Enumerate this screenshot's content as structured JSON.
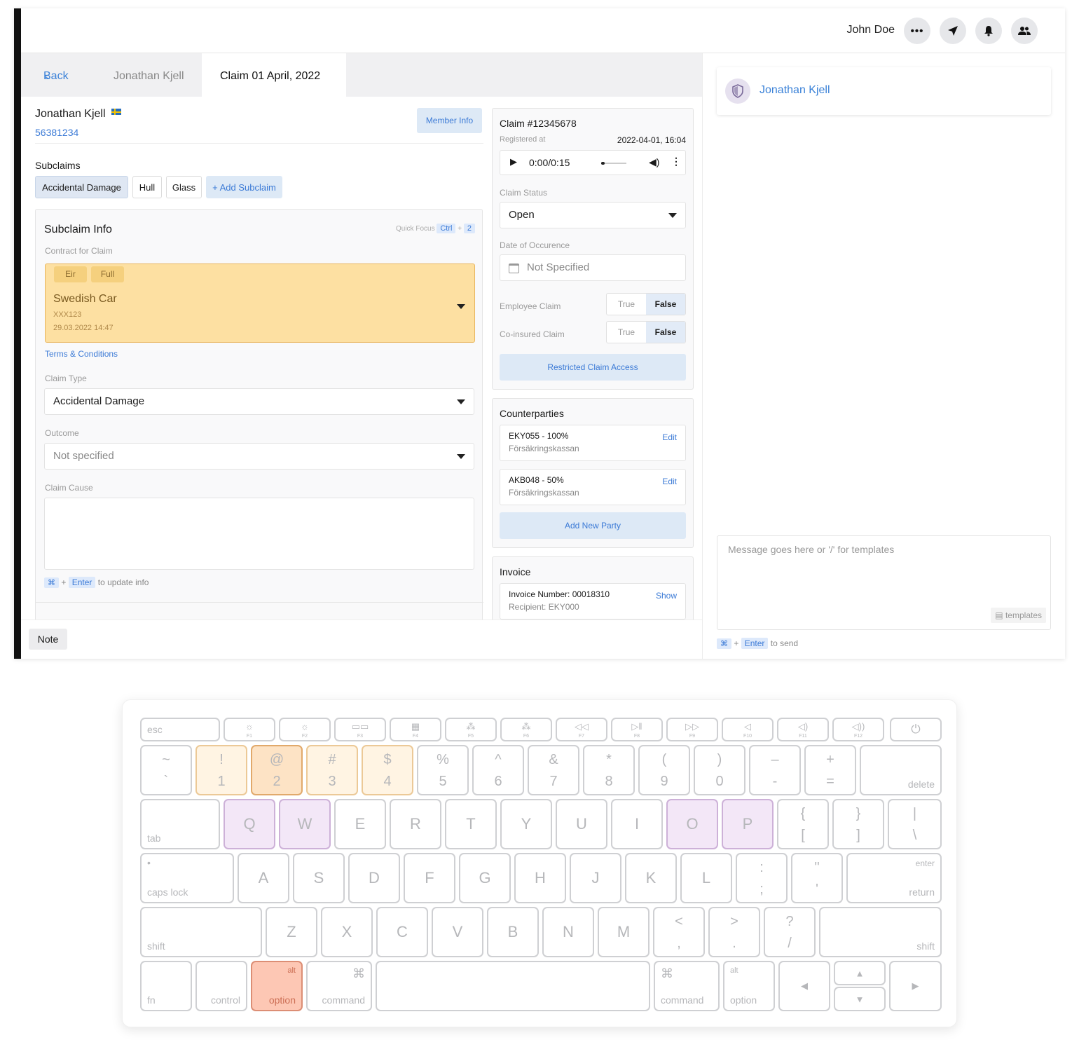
{
  "topbar": {
    "user": "John Doe",
    "dots_icon": "ellipsis-icon",
    "send_icon": "send-icon",
    "bell_icon": "bell-icon",
    "people_icon": "users-icon",
    "expand_glyph": "›"
  },
  "tabs": {
    "back": "Back",
    "member": "Jonathan Kjell",
    "claim": "Claim 01 April, 2022"
  },
  "member": {
    "name": "Jonathan Kjell",
    "flag": "sweden-flag",
    "id": "56381234",
    "info_button": "Member Info"
  },
  "subclaims": {
    "label": "Subclaims",
    "items": [
      "Accidental Damage",
      "Hull",
      "Glass"
    ],
    "add": "+ Add Subclaim"
  },
  "subclaim_info": {
    "title": "Subclaim Info",
    "quick_focus": "Quick Focus",
    "qf_key1": "Ctrl",
    "qf_plus": "+",
    "qf_key2": "2",
    "contract_label": "Contract for Claim",
    "contract_tags": [
      "Eir",
      "Full"
    ],
    "contract_title": "Swedish Car",
    "contract_reg": "XXX123",
    "contract_date": "29.03.2022 14:47",
    "terms": "Terms & Conditions",
    "claim_type_label": "Claim Type",
    "claim_type": "Accidental Damage",
    "outcome_label": "Outcome",
    "outcome": "Not specified",
    "cause_label": "Claim Cause",
    "hint_key1": "⌘",
    "hint_plus": "+",
    "hint_key2": "Enter",
    "hint_text": "to update info"
  },
  "note": "Note",
  "claim": {
    "number": "Claim #12345678",
    "registered_label": "Registered at",
    "registered": "2022-04-01, 16:04",
    "audio_time": "0:00/0:15",
    "status_label": "Claim Status",
    "status": "Open",
    "date_label": "Date of Occurence",
    "date": "Not Specified",
    "employee_label": "Employee Claim",
    "coinsured_label": "Co-insured Claim",
    "true_label": "True",
    "false_label": "False",
    "restricted": "Restricted Claim Access"
  },
  "counterparties": {
    "title": "Counterparties",
    "items": [
      {
        "name": "EKY055 - 100%",
        "org": "Försäkringskassan",
        "edit": "Edit"
      },
      {
        "name": "AKB048 - 50%",
        "org": "Försäkringskassan",
        "edit": "Edit"
      }
    ],
    "add": "Add New Party"
  },
  "invoice": {
    "title": "Invoice",
    "number": "Invoice Number: 00018310",
    "recipient": "Recipient: EKY000",
    "show": "Show"
  },
  "chat": {
    "contact": "Jonathan Kjell",
    "placeholder": "Message goes here or '/' for templates",
    "templates": "templates",
    "hint_key1": "⌘",
    "hint_plus": "+",
    "hint_key2": "Enter",
    "hint_text": "to send"
  },
  "keyboard": {
    "esc": "esc",
    "fn_keys": [
      "F1",
      "F2",
      "F3",
      "F4",
      "F5",
      "F6",
      "F7",
      "F8",
      "F9",
      "F10",
      "F11",
      "F12"
    ],
    "fn_icons": [
      "☼",
      "☼",
      "▭▭",
      "▦",
      "⁂",
      "⁂",
      "◁◁",
      "▷‖",
      "▷▷",
      "◁",
      "◁)",
      "◁))"
    ],
    "power": "⏻",
    "row1": [
      [
        "~",
        "`"
      ],
      [
        "!",
        "1"
      ],
      [
        "@",
        "2"
      ],
      [
        "#",
        "3"
      ],
      [
        "$",
        "4"
      ],
      [
        "%",
        "5"
      ],
      [
        "^",
        "6"
      ],
      [
        "&",
        "7"
      ],
      [
        "*",
        "8"
      ],
      [
        "(",
        "9"
      ],
      [
        ")",
        "0"
      ],
      [
        "–",
        "-"
      ],
      [
        "+",
        "="
      ]
    ],
    "delete": "delete",
    "tab": "tab",
    "row2": [
      "Q",
      "W",
      "E",
      "R",
      "T",
      "Y",
      "U",
      "I",
      "O",
      "P"
    ],
    "row2b": [
      [
        "{",
        "["
      ],
      [
        "}",
        "]"
      ],
      [
        "|",
        "\\"
      ]
    ],
    "caps_dot": "•",
    "caps": "caps lock",
    "row3": [
      "A",
      "S",
      "D",
      "F",
      "G",
      "H",
      "J",
      "K",
      "L"
    ],
    "row3b": [
      [
        ":",
        ";"
      ],
      [
        "\"",
        "'"
      ]
    ],
    "enter": "enter",
    "return": "return",
    "shift": "shift",
    "row4": [
      "Z",
      "X",
      "C",
      "V",
      "B",
      "N",
      "M"
    ],
    "row4b": [
      [
        "<",
        ","
      ],
      [
        ">",
        "."
      ],
      [
        "?",
        "/"
      ]
    ],
    "fn": "fn",
    "control": "control",
    "alt": "alt",
    "option": "option",
    "cmd_sym": "⌘",
    "command": "command",
    "arrow_left": "◀",
    "arrow_up": "▲",
    "arrow_down": "▼",
    "arrow_right": "▶"
  }
}
